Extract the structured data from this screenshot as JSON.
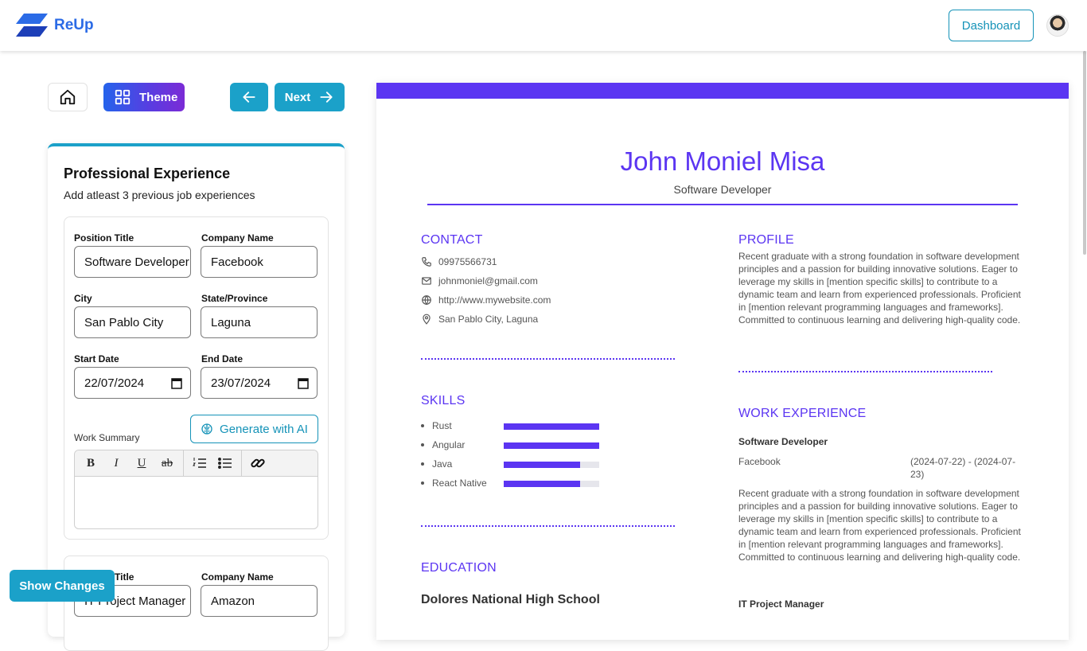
{
  "header": {
    "brand": "ReUp",
    "dashboard_label": "Dashboard"
  },
  "toolbar": {
    "theme_label": "Theme",
    "next_label": "Next"
  },
  "form": {
    "title": "Professional Experience",
    "subtitle": "Add atleast 3 previous job experiences",
    "entries": [
      {
        "position_label": "Position Title",
        "position": "Software Developer",
        "company_label": "Company Name",
        "company": "Facebook",
        "city_label": "City",
        "city": "San Pablo City",
        "state_label": "State/Province",
        "state": "Laguna",
        "start_label": "Start Date",
        "start": "22/07/2024",
        "end_label": "End Date",
        "end": "23/07/2024",
        "summary_label": "Work Summary",
        "generate_label": "Generate with AI"
      },
      {
        "position_label": "Title",
        "position": "IT Project Manager",
        "company_label": "Company Name",
        "company": "Amazon"
      }
    ]
  },
  "show_changes_label": "Show Changes",
  "resume": {
    "name": "John Moniel Misa",
    "role": "Software Developer",
    "accent": "#5b35f2",
    "contact": {
      "heading": "CONTACT",
      "phone": "09975566731",
      "email": "johnmoniel@gmail.com",
      "website": "http://www.mywebsite.com",
      "location": "San Pablo City, Laguna"
    },
    "profile": {
      "heading": "PROFILE",
      "text": "Recent graduate with a strong foundation in software development principles and a passion for building innovative solutions. Eager to leverage my skills in [mention specific skills] to contribute to a dynamic team and learn from experienced professionals. Proficient in [mention relevant programming languages and frameworks]. Committed to continuous learning and delivering high-quality code."
    },
    "skills": {
      "heading": "SKILLS",
      "items": [
        {
          "name": "Rust",
          "level": 1.0
        },
        {
          "name": "Angular",
          "level": 1.0
        },
        {
          "name": "Java",
          "level": 0.8
        },
        {
          "name": "React Native",
          "level": 0.8
        }
      ]
    },
    "education": {
      "heading": "EDUCATION",
      "school": "Dolores National High School"
    },
    "work": {
      "heading": "WORK EXPERIENCE",
      "jobs": [
        {
          "title": "Software Developer",
          "company": "Facebook",
          "dates": "(2024-07-22) - (2024-07-23)",
          "summary": "Recent graduate with a strong foundation in software development principles and a passion for building innovative solutions. Eager to leverage my skills in [mention specific skills] to contribute to a dynamic team and learn from experienced professionals. Proficient in [mention relevant programming languages and frameworks]. Committed to continuous learning and delivering high-quality code."
        },
        {
          "title": "IT Project Manager"
        }
      ]
    }
  }
}
